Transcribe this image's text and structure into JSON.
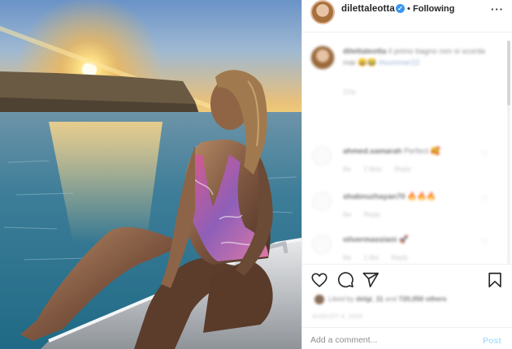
{
  "post": {
    "username": "dilettaleotta",
    "verified": true,
    "separator": "•",
    "follow_label": "Following",
    "more_icon": "more-horizontal-icon"
  },
  "caption": {
    "username": "dilettaleotta",
    "text": "il primo bagno non si scorda mai",
    "emoji": "😄😂",
    "hashtag": "#summer22",
    "time": "22w"
  },
  "comments": [
    {
      "username": "ahmed.samarah",
      "text": "Perfect",
      "emoji": "🥰",
      "time": "8w",
      "likes": "2 likes",
      "reply": "Reply"
    },
    {
      "username": "shabnuzhayan70",
      "text": "",
      "emoji": "🔥🔥🔥",
      "time": "8w",
      "likes": "",
      "reply": "Reply"
    },
    {
      "username": "olivermassiani",
      "text": "",
      "emoji": "🚀",
      "time": "8w",
      "likes": "1 like",
      "reply": "Reply"
    }
  ],
  "actions": {
    "like_icon": "heart-icon",
    "comment_icon": "comment-icon",
    "share_icon": "share-icon",
    "save_icon": "bookmark-icon"
  },
  "likes": {
    "prefix": "Liked by",
    "user": "delgi_11",
    "middle": "and",
    "count": "720,050 others"
  },
  "post_date": "AUGUST 4, 2020",
  "comment_box": {
    "placeholder": "Add a comment...",
    "post_label": "Post"
  },
  "colors": {
    "text": "#262626",
    "muted": "#8e8e8e",
    "border": "#efefef",
    "verified": "#3897f0",
    "post_disabled": "#b2dffc"
  }
}
